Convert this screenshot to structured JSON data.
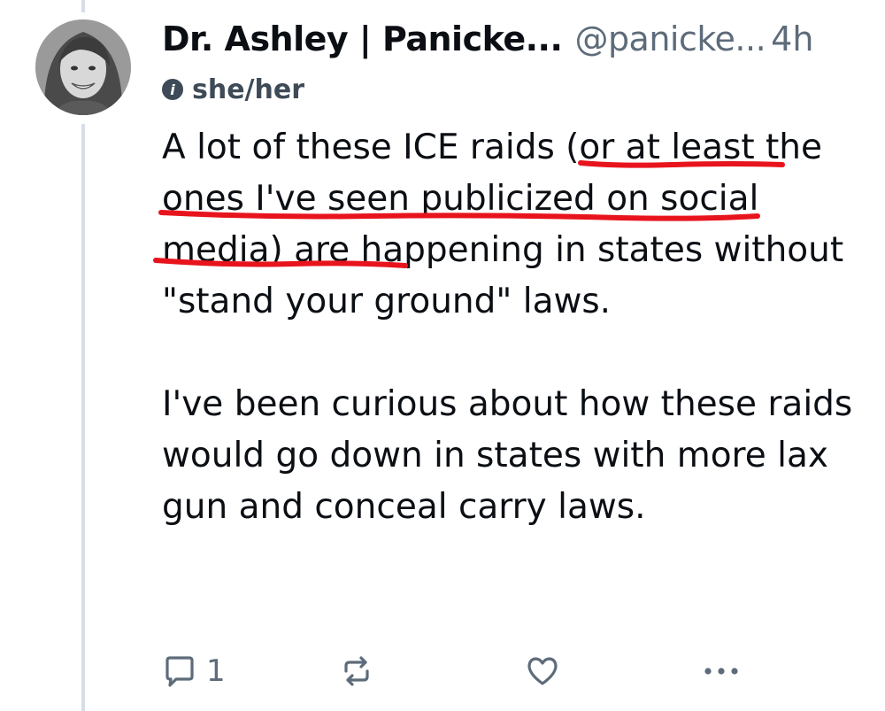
{
  "post": {
    "author": {
      "display_name": "Dr. Ashley | Panicke...",
      "handle": "@panicke...",
      "timestamp": "4h",
      "pronouns": "she/her"
    },
    "text": {
      "p1": "A lot of these ICE raids (or at least the ones I've seen publicized on social media) are happening in states without \"stand your ground\" laws.",
      "p2": "I've been curious about how these raids would go down in states with more lax gun and conceal carry laws."
    },
    "actions": {
      "reply_count": "1",
      "reply_icon": "comment-icon",
      "repost_icon": "repost-icon",
      "like_icon": "heart-icon",
      "more_icon": "ellipsis-icon"
    },
    "colors": {
      "text": "#0b0f14",
      "muted": "#5d6b7a",
      "annotation": "#e8141d",
      "thread_line": "#d7dee7"
    }
  }
}
